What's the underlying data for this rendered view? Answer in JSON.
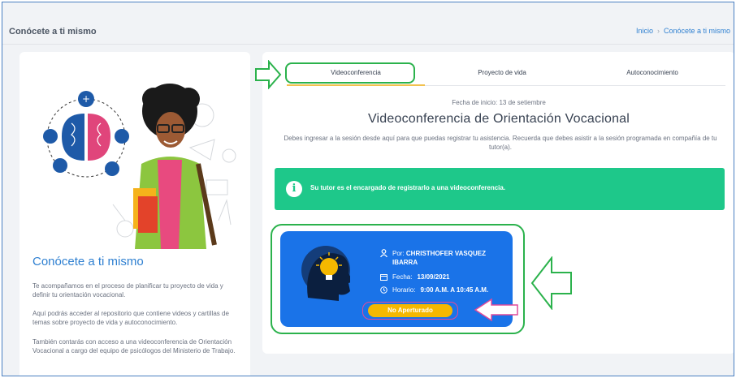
{
  "header": {
    "title": "Conócete a ti mismo",
    "breadcrumb": {
      "home": "Inicio",
      "sep": "›",
      "current": "Conócete a ti mismo"
    }
  },
  "left": {
    "title": "Conócete a ti mismo",
    "paragraphs": [
      "Te acompañamos en el proceso de planificar tu proyecto de vida y definir tu orientación vocacional.",
      "Aquí podrás acceder al repositorio que contiene videos y cartillas de temas sobre proyecto de vida y autoconocimiento.",
      "También contarás con acceso a una videoconferencia de Orientación Vocacional a cargo del equipo de psicólogos del Ministerio de Trabajo."
    ]
  },
  "tabs": [
    {
      "label": "Videoconferencia",
      "active": true
    },
    {
      "label": "Proyecto de vida",
      "active": false
    },
    {
      "label": "Autoconocimiento",
      "active": false
    }
  ],
  "main": {
    "date_line": "Fecha de inicio: 13 de setiembre",
    "heading": "Videoconferencia de Orientación Vocacional",
    "description": "Debes ingresar a la sesión desde aquí para que puedas registrar tu asistencia. Recuerda que debes asistir a la sesión programada en compañía de tu tutor(a).",
    "alert_icon": "i",
    "alert": "Su tutor es el encargado de registrarlo a una videoconferencia."
  },
  "session": {
    "by_label": "Por:",
    "by_name": "CHRISTHOFER VASQUEZ IBARRA",
    "date_label": "Fecha:",
    "date_value": "13/09/2021",
    "time_label": "Horario:",
    "time_value": "9:00 A.M. A 10:45 A.M.",
    "status": "No Aperturado"
  },
  "colors": {
    "accent_blue": "#1a73e8",
    "alert_green": "#1ec88a",
    "badge_yellow": "#f5b800",
    "annotation_green": "#2bb24c",
    "annotation_pink": "#e04b9b"
  }
}
